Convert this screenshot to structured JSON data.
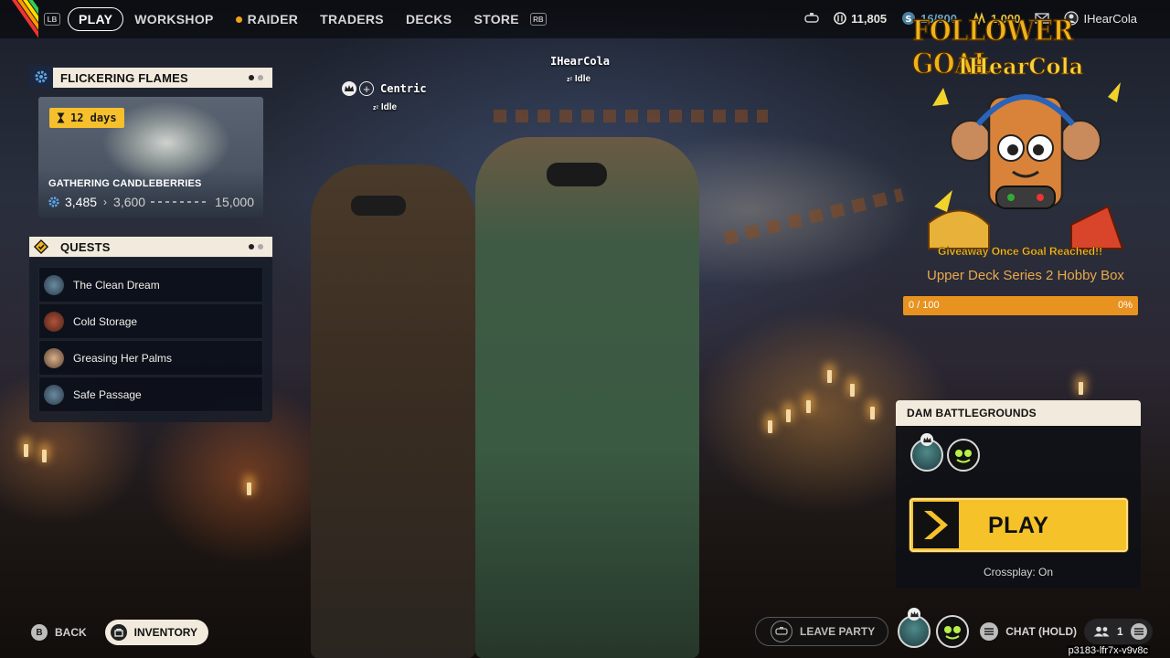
{
  "nav": {
    "lb": "LB",
    "rb": "RB",
    "items": [
      "PLAY",
      "WORKSHOP",
      "RAIDER",
      "TRADERS",
      "DECKS",
      "STORE"
    ]
  },
  "stats": {
    "coins": "11,805",
    "capacity": "16/800",
    "tokens": "1,000",
    "username": "IHearCola"
  },
  "event": {
    "title": "FLICKERING FLAMES",
    "timer": "12 days",
    "name": "GATHERING CANDLEBERRIES",
    "current": "3,485",
    "next": "3,600",
    "max": "15,000"
  },
  "quests": {
    "title": "QUESTS",
    "items": [
      "The Clean Dream",
      "Cold Storage",
      "Greasing Her Palms",
      "Safe Passage"
    ]
  },
  "players": {
    "left_name": "Centric",
    "left_status": "Idle",
    "right_name": "IHearCola",
    "right_status": "Idle"
  },
  "follower_goal": {
    "title": "FOLLOWER GOAL",
    "user": "IHearCola",
    "giveaway": "Giveaway Once Goal Reached!!",
    "prize": "Upper Deck Series 2 Hobby Box",
    "progress_text": "0 / 100",
    "progress_pct": "0%",
    "progress_value": 0
  },
  "match": {
    "map": "DAM BATTLEGROUNDS",
    "play_label": "PLAY",
    "crossplay": "Crossplay: On"
  },
  "bottom": {
    "back_key": "B",
    "back": "BACK",
    "inventory": "INVENTORY",
    "leave_party": "LEAVE PARTY",
    "chat": "CHAT (HOLD)",
    "party_count": "1",
    "session_id": "p3183-lfr7x-v9v8c"
  },
  "icons": {
    "gear": "gear-icon",
    "diamond": "quest-diamond-icon",
    "hourglass": "hourglass-icon"
  }
}
